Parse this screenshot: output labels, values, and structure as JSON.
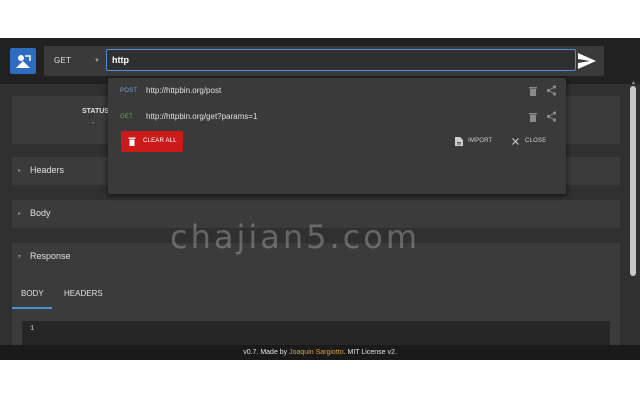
{
  "toolbar": {
    "method": "GET",
    "url_value": "http",
    "send_icon": "send-icon"
  },
  "status": {
    "label": "STATUS",
    "value": "-"
  },
  "panels": {
    "headers_title": "Headers",
    "body_title": "Body",
    "response_title": "Response"
  },
  "response_tabs": [
    {
      "label": "BODY",
      "active": true
    },
    {
      "label": "HEADERS",
      "active": false
    }
  ],
  "editor": {
    "line_number": "1"
  },
  "history": {
    "items": [
      {
        "method": "POST",
        "method_color": "#6fa8dc",
        "url": "http://httpbin.org/post"
      },
      {
        "method": "GET",
        "method_color": "#6aa84f",
        "url": "http://httpbin.org/get?params=1"
      }
    ],
    "clear_label": "CLEAR ALL",
    "import_label": "IMPORT",
    "close_label": "CLOSE"
  },
  "footer": {
    "prefix": "v0.7. Made by ",
    "author": "Joaquin Sargiotto",
    "suffix": ". MIT License v2."
  },
  "watermark": "chajian5.com",
  "colors": {
    "accent": "#4a90d9",
    "danger": "#cc1a1a",
    "background": "#303030",
    "topbar": "#212121"
  }
}
